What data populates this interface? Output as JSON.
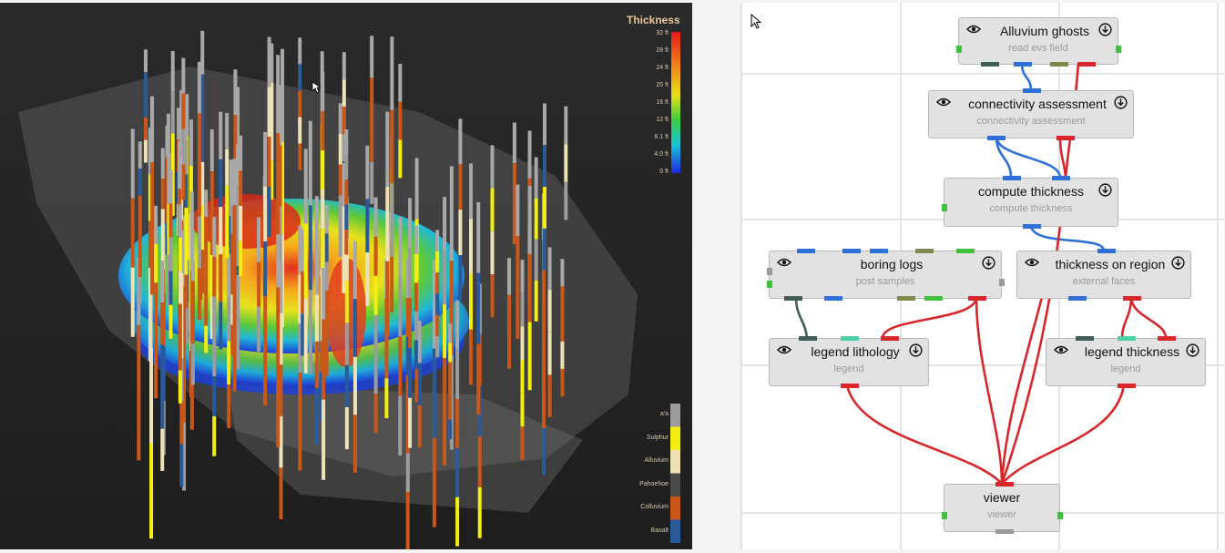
{
  "viewport": {
    "colorbar": {
      "title": "Thickness",
      "ticks": [
        "32 ft",
        "28 ft",
        "24 ft",
        "20 ft",
        "16 ft",
        "12 ft",
        "8.1 ft",
        "4.0 ft",
        "0 ft"
      ]
    },
    "lithology_legend": [
      {
        "label": "a'a",
        "color": "#9c9c9c"
      },
      {
        "label": "Sulphur",
        "color": "#f2ee12"
      },
      {
        "label": "Alluvium",
        "color": "#ece2b6"
      },
      {
        "label": "Pahoehoe",
        "color": "#4a4a4a"
      },
      {
        "label": "Colluvium",
        "color": "#c9571a"
      },
      {
        "label": "Basalt",
        "color": "#2b5a9a"
      }
    ]
  },
  "network": {
    "nodes": {
      "alluvium_ghosts": {
        "title": "Alluvium ghosts",
        "subtitle": "read evs field"
      },
      "connectivity": {
        "title": "connectivity assessment",
        "subtitle": "connectivity assessment"
      },
      "compute_thickness": {
        "title": "compute thickness",
        "subtitle": "compute thickness"
      },
      "boring_logs": {
        "title": "boring logs",
        "subtitle": "post samples"
      },
      "thickness_region": {
        "title": "thickness on region",
        "subtitle": "external faces"
      },
      "legend_lithology": {
        "title": "legend lithology",
        "subtitle": "legend"
      },
      "legend_thickness": {
        "title": "legend thickness",
        "subtitle": "legend"
      },
      "viewer": {
        "title": "viewer",
        "subtitle": "viewer"
      }
    },
    "port_colors": {
      "blue": "#2f6fd8",
      "red": "#d8262a",
      "teal": "#3e5e57",
      "olive": "#7d8a4e",
      "green": "#3cc23c",
      "mint": "#4fd0a8",
      "gray": "#9a9a9a"
    }
  }
}
